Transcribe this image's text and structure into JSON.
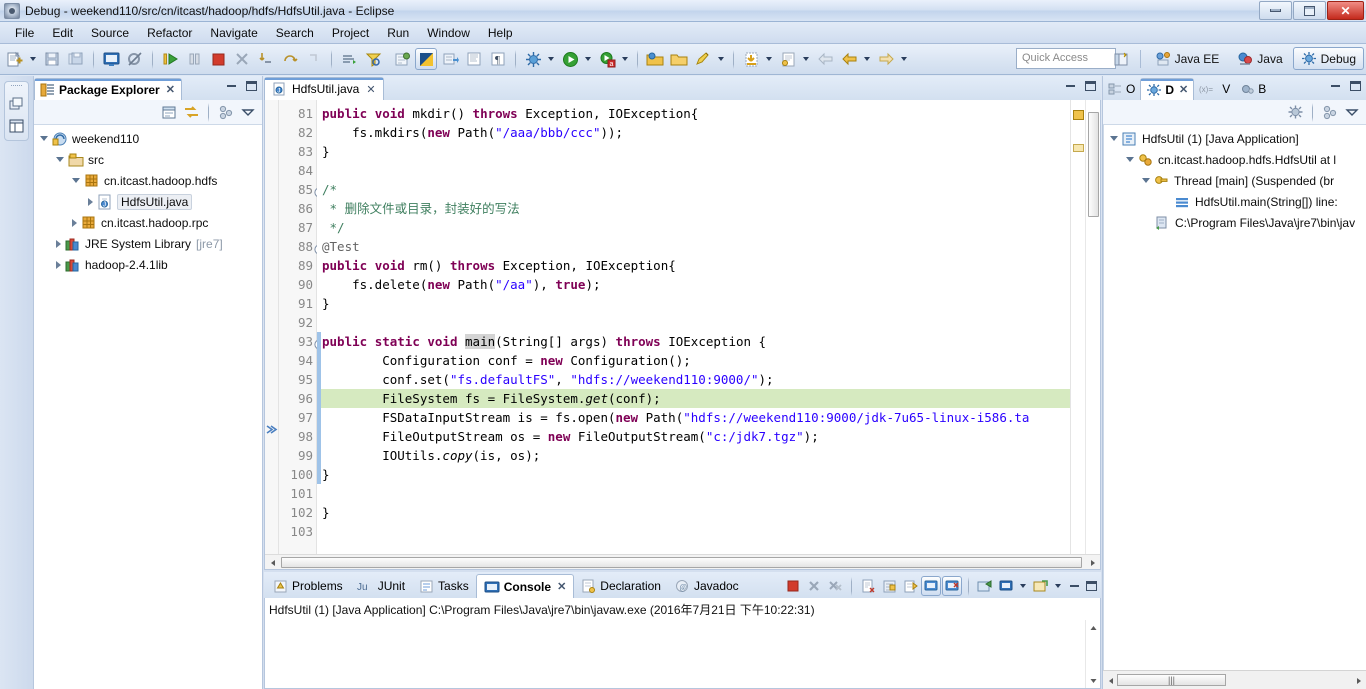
{
  "window": {
    "title": "Debug - weekend110/src/cn/itcast/hadoop/hdfs/HdfsUtil.java - Eclipse",
    "minimize": "–",
    "maximize": "❐",
    "close": "✕"
  },
  "menu": [
    "File",
    "Edit",
    "Source",
    "Refactor",
    "Navigate",
    "Search",
    "Project",
    "Run",
    "Window",
    "Help"
  ],
  "toolbar": {
    "quick_access_placeholder": "Quick Access",
    "perspectives": [
      {
        "label": "Java EE",
        "selected": false
      },
      {
        "label": "Java",
        "selected": false
      },
      {
        "label": "Debug",
        "selected": true
      }
    ]
  },
  "package_explorer": {
    "tab": "Package Explorer",
    "tree": [
      {
        "label": "weekend110",
        "indent": 0,
        "twisty": "open",
        "icon": "project-icon"
      },
      {
        "label": "src",
        "indent": 1,
        "twisty": "open",
        "icon": "source-folder-icon"
      },
      {
        "label": "cn.itcast.hadoop.hdfs",
        "indent": 2,
        "twisty": "open",
        "icon": "package-icon"
      },
      {
        "label": "HdfsUtil.java",
        "indent": 3,
        "twisty": "closed",
        "icon": "java-file-icon",
        "selected": true
      },
      {
        "label": "cn.itcast.hadoop.rpc",
        "indent": 2,
        "twisty": "closed",
        "icon": "package-icon"
      },
      {
        "label": "JRE System Library",
        "suffix": "[jre7]",
        "indent": 1,
        "twisty": "closed",
        "icon": "library-icon"
      },
      {
        "label": "hadoop-2.4.1lib",
        "indent": 1,
        "twisty": "closed",
        "icon": "library-icon"
      }
    ]
  },
  "editor": {
    "tab": "HdfsUtil.java",
    "lines": [
      {
        "n": 81,
        "fold": "none",
        "marker": "none",
        "tokens": [
          {
            "t": "public ",
            "c": "kw"
          },
          {
            "t": "void ",
            "c": "kw"
          },
          {
            "t": "mkdir() ",
            "c": ""
          },
          {
            "t": "throws ",
            "c": "kw"
          },
          {
            "t": "Exception, IOException{",
            "c": ""
          }
        ]
      },
      {
        "n": 82,
        "fold": "none",
        "marker": "none",
        "tokens": [
          {
            "t": "    fs.mkdirs(",
            "c": ""
          },
          {
            "t": "new ",
            "c": "kw"
          },
          {
            "t": "Path(",
            "c": ""
          },
          {
            "t": "\"/aaa/bbb/ccc\"",
            "c": "str"
          },
          {
            "t": "));",
            "c": ""
          }
        ]
      },
      {
        "n": 83,
        "fold": "none",
        "marker": "none",
        "tokens": [
          {
            "t": "}",
            "c": ""
          }
        ]
      },
      {
        "n": 84,
        "fold": "none",
        "marker": "none",
        "tokens": [
          {
            "t": "",
            "c": ""
          }
        ]
      },
      {
        "n": 85,
        "fold": "open",
        "marker": "none",
        "tokens": [
          {
            "t": "/*",
            "c": "cmt"
          }
        ]
      },
      {
        "n": 86,
        "fold": "none",
        "marker": "none",
        "tokens": [
          {
            "t": " * 删除文件或目录，封装好的写法",
            "c": "cmt"
          }
        ]
      },
      {
        "n": 87,
        "fold": "none",
        "marker": "none",
        "tokens": [
          {
            "t": " */",
            "c": "cmt"
          }
        ]
      },
      {
        "n": 88,
        "fold": "open",
        "marker": "none",
        "tokens": [
          {
            "t": "@Test",
            "c": "ann"
          }
        ]
      },
      {
        "n": 89,
        "fold": "none",
        "marker": "none",
        "tokens": [
          {
            "t": "public ",
            "c": "kw"
          },
          {
            "t": "void ",
            "c": "kw"
          },
          {
            "t": "rm() ",
            "c": ""
          },
          {
            "t": "throws ",
            "c": "kw"
          },
          {
            "t": "Exception, IOException{",
            "c": ""
          }
        ]
      },
      {
        "n": 90,
        "fold": "none",
        "marker": "none",
        "tokens": [
          {
            "t": "    fs.delete(",
            "c": ""
          },
          {
            "t": "new ",
            "c": "kw"
          },
          {
            "t": "Path(",
            "c": ""
          },
          {
            "t": "\"/aa\"",
            "c": "str"
          },
          {
            "t": "), ",
            "c": ""
          },
          {
            "t": "true",
            "c": "kw"
          },
          {
            "t": ");",
            "c": ""
          }
        ]
      },
      {
        "n": 91,
        "fold": "none",
        "marker": "none",
        "tokens": [
          {
            "t": "}",
            "c": ""
          }
        ]
      },
      {
        "n": 92,
        "fold": "none",
        "marker": "none",
        "tokens": [
          {
            "t": "",
            "c": ""
          }
        ]
      },
      {
        "n": 93,
        "fold": "open",
        "marker": "stack",
        "tokens": [
          {
            "t": "public ",
            "c": "kw"
          },
          {
            "t": "static ",
            "c": "kw"
          },
          {
            "t": "void ",
            "c": "kw"
          },
          {
            "t": "main",
            "c": "sel"
          },
          {
            "t": "(String[] args) ",
            "c": ""
          },
          {
            "t": "throws ",
            "c": "kw"
          },
          {
            "t": "IOException {",
            "c": ""
          }
        ]
      },
      {
        "n": 94,
        "fold": "none",
        "marker": "stack",
        "tokens": [
          {
            "t": "        Configuration conf = ",
            "c": ""
          },
          {
            "t": "new ",
            "c": "kw"
          },
          {
            "t": "Configuration();",
            "c": ""
          }
        ]
      },
      {
        "n": 95,
        "fold": "none",
        "marker": "stack",
        "tokens": [
          {
            "t": "        conf.set(",
            "c": ""
          },
          {
            "t": "\"fs.defaultFS\"",
            "c": "str"
          },
          {
            "t": ", ",
            "c": ""
          },
          {
            "t": "\"hdfs://weekend110:9000/\"",
            "c": "str"
          },
          {
            "t": ");",
            "c": ""
          }
        ]
      },
      {
        "n": 96,
        "fold": "none",
        "marker": "current",
        "highlight": "debug",
        "tokens": [
          {
            "t": "        FileSystem fs = FileSystem.",
            "c": ""
          },
          {
            "t": "get",
            "c": "itl"
          },
          {
            "t": "(conf);",
            "c": ""
          }
        ]
      },
      {
        "n": 97,
        "fold": "none",
        "marker": "stack",
        "tokens": [
          {
            "t": "        FSDataInputStream is = fs.open(",
            "c": ""
          },
          {
            "t": "new ",
            "c": "kw"
          },
          {
            "t": "Path(",
            "c": ""
          },
          {
            "t": "\"hdfs://weekend110:9000/jdk-7u65-linux-i586.ta",
            "c": "str"
          }
        ]
      },
      {
        "n": 98,
        "fold": "none",
        "marker": "stack",
        "tokens": [
          {
            "t": "        FileOutputStream os = ",
            "c": ""
          },
          {
            "t": "new ",
            "c": "kw"
          },
          {
            "t": "FileOutputStream(",
            "c": ""
          },
          {
            "t": "\"c:/jdk7.tgz\"",
            "c": "str"
          },
          {
            "t": ");",
            "c": ""
          }
        ]
      },
      {
        "n": 99,
        "fold": "none",
        "marker": "stack",
        "tokens": [
          {
            "t": "        IOUtils.",
            "c": ""
          },
          {
            "t": "copy",
            "c": "itl"
          },
          {
            "t": "(is, os);",
            "c": ""
          }
        ]
      },
      {
        "n": 100,
        "fold": "none",
        "marker": "stack",
        "tokens": [
          {
            "t": "}",
            "c": ""
          }
        ]
      },
      {
        "n": 101,
        "fold": "none",
        "marker": "none",
        "tokens": [
          {
            "t": "",
            "c": ""
          }
        ]
      },
      {
        "n": 102,
        "fold": "none",
        "marker": "none",
        "tokens": [
          {
            "t": "}",
            "c": ""
          }
        ]
      },
      {
        "n": 103,
        "fold": "none",
        "marker": "none",
        "tokens": [
          {
            "t": "",
            "c": ""
          }
        ]
      }
    ]
  },
  "console": {
    "tabs": [
      {
        "label": "Problems",
        "icon": "problems-icon",
        "active": false
      },
      {
        "label": "JUnit",
        "icon": "junit-icon",
        "active": false
      },
      {
        "label": "Tasks",
        "icon": "tasks-icon",
        "active": false
      },
      {
        "label": "Console",
        "icon": "console-icon",
        "active": true
      },
      {
        "label": "Declaration",
        "icon": "declaration-icon",
        "active": false
      },
      {
        "label": "Javadoc",
        "icon": "javadoc-icon",
        "active": false
      }
    ],
    "header": "HdfsUtil (1) [Java Application] C:\\Program Files\\Java\\jre7\\bin\\javaw.exe (2016年7月21日 下午10:22:31)"
  },
  "debug_view": {
    "tabs": [
      {
        "label": "O",
        "icon": "outline-icon",
        "active": false
      },
      {
        "label": "D",
        "icon": "debug-icon",
        "active": true
      },
      {
        "label": "V",
        "icon": "variables-icon",
        "active": false
      },
      {
        "label": "B",
        "icon": "breakpoints-icon",
        "active": false
      }
    ],
    "tree": [
      {
        "label": "HdfsUtil (1) [Java Application]",
        "indent": 0,
        "twisty": "open",
        "icon": "launch-icon"
      },
      {
        "label": "cn.itcast.hadoop.hdfs.HdfsUtil at l",
        "indent": 1,
        "twisty": "open",
        "icon": "debug-target-icon"
      },
      {
        "label": "Thread [main] (Suspended (br",
        "indent": 2,
        "twisty": "open",
        "icon": "thread-icon"
      },
      {
        "label": "HdfsUtil.main(String[]) line:",
        "indent": 3,
        "twisty": "none",
        "icon": "stackframe-icon"
      },
      {
        "label": "C:\\Program Files\\Java\\jre7\\bin\\jav",
        "indent": 1,
        "twisty": "none",
        "icon": "process-icon"
      }
    ]
  },
  "colors": {
    "keyword": "#7f0055",
    "string": "#2a00ff",
    "comment": "#3f7f5f",
    "debug_highlight": "#d6eac0",
    "accent": "#6f9ed8"
  }
}
